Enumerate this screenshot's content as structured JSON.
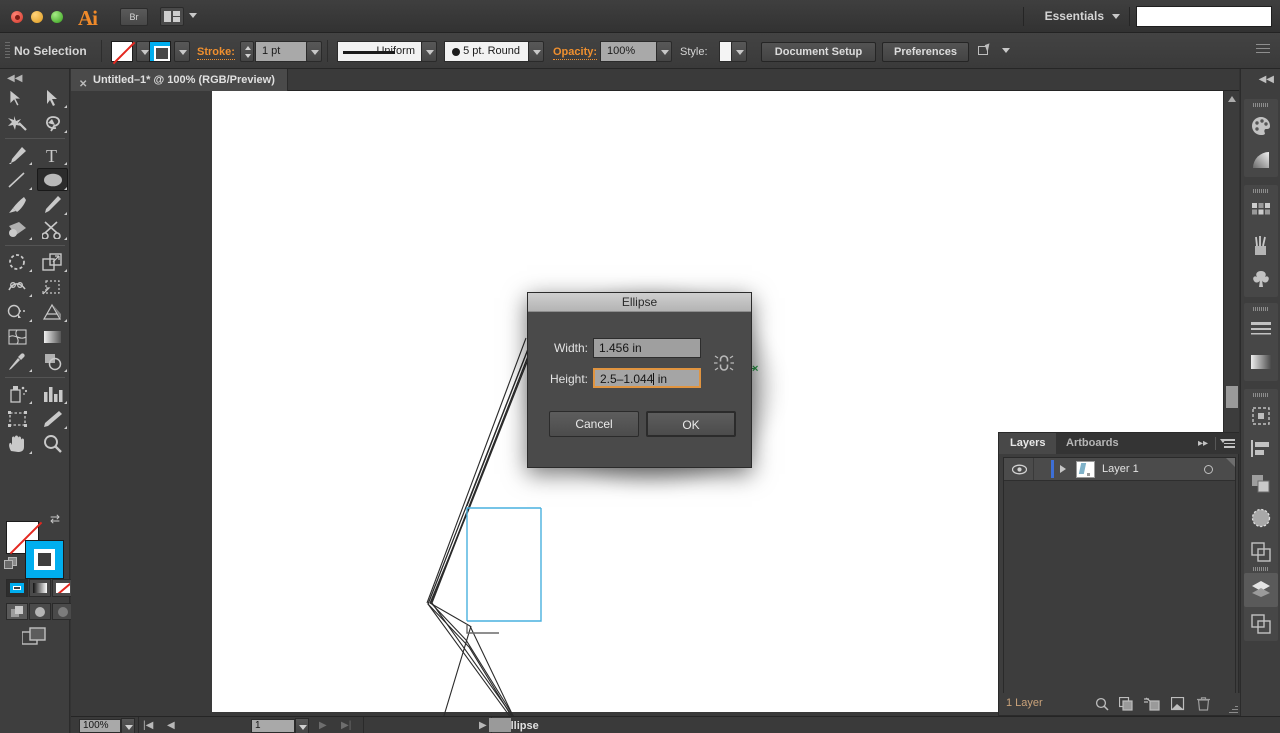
{
  "app": {
    "name": "Adobe Illustrator",
    "logo_text": "Ai",
    "bridge_button": "Br",
    "workspace": "Essentials",
    "search_value": ""
  },
  "control_bar": {
    "selection_status": "No Selection",
    "stroke_label": "Stroke:",
    "stroke_weight": "1 pt",
    "stroke_profile": "Uniform",
    "brush_definition": "5 pt. Round",
    "opacity_label": "Opacity:",
    "opacity_value": "100%",
    "style_label": "Style:",
    "document_setup_button": "Document Setup",
    "preferences_button": "Preferences"
  },
  "document": {
    "tab_title": "Untitled–1* @ 100% (RGB/Preview)"
  },
  "tools": [
    {
      "name": "selection-tool",
      "label": "Selection",
      "selected": false
    },
    {
      "name": "direct-selection-tool",
      "label": "Direct Selection",
      "selected": false
    },
    {
      "name": "magic-wand-tool",
      "label": "Magic Wand",
      "selected": false
    },
    {
      "name": "lasso-tool",
      "label": "Lasso",
      "selected": false
    },
    {
      "name": "pen-tool",
      "label": "Pen",
      "selected": false
    },
    {
      "name": "type-tool",
      "label": "Type",
      "selected": false
    },
    {
      "name": "line-segment-tool",
      "label": "Line Segment",
      "selected": false
    },
    {
      "name": "ellipse-tool",
      "label": "Ellipse",
      "selected": true
    },
    {
      "name": "paintbrush-tool",
      "label": "Paintbrush",
      "selected": false
    },
    {
      "name": "pencil-tool",
      "label": "Pencil",
      "selected": false
    },
    {
      "name": "blob-brush-tool",
      "label": "Blob Brush",
      "selected": false
    },
    {
      "name": "scissors-tool",
      "label": "Scissors",
      "selected": false
    },
    {
      "name": "rotate-tool",
      "label": "Rotate",
      "selected": false
    },
    {
      "name": "scale-tool",
      "label": "Scale",
      "selected": false
    },
    {
      "name": "width-tool",
      "label": "Width",
      "selected": false
    },
    {
      "name": "free-transform-tool",
      "label": "Free Transform",
      "selected": false
    },
    {
      "name": "shape-builder-tool",
      "label": "Shape Builder",
      "selected": false
    },
    {
      "name": "perspective-grid-tool",
      "label": "Perspective Grid",
      "selected": false
    },
    {
      "name": "mesh-tool",
      "label": "Mesh",
      "selected": false
    },
    {
      "name": "gradient-tool",
      "label": "Gradient",
      "selected": false
    },
    {
      "name": "eyedropper-tool",
      "label": "Eyedropper",
      "selected": false
    },
    {
      "name": "blend-tool",
      "label": "Blend",
      "selected": false
    },
    {
      "name": "symbol-sprayer-tool",
      "label": "Symbol Sprayer",
      "selected": false
    },
    {
      "name": "column-graph-tool",
      "label": "Column Graph",
      "selected": false
    },
    {
      "name": "artboard-tool",
      "label": "Artboard",
      "selected": false
    },
    {
      "name": "slice-tool",
      "label": "Slice",
      "selected": false
    },
    {
      "name": "hand-tool",
      "label": "Hand",
      "selected": false
    },
    {
      "name": "zoom-tool",
      "label": "Zoom",
      "selected": false
    }
  ],
  "color_controls": {
    "fill": "none",
    "stroke_color": "#00aeef",
    "modes": [
      "color",
      "gradient",
      "none"
    ],
    "draw_modes": [
      "draw-normal",
      "draw-behind",
      "draw-inside"
    ],
    "active_mode": "color",
    "active_draw_mode": "draw-normal"
  },
  "dialog": {
    "title": "Ellipse",
    "width_label": "Width:",
    "width_value": "1.456 in",
    "height_label": "Height:",
    "height_value": "2.5–1.044",
    "height_unit": "in",
    "constrain_icon": "chain-link-icon",
    "cancel_button": "Cancel",
    "ok_button": "OK",
    "focused_field": "height",
    "accent_color": "#e09440"
  },
  "layers_panel": {
    "tabs": [
      {
        "label": "Layers",
        "active": true
      },
      {
        "label": "Artboards",
        "active": false
      }
    ],
    "rows": [
      {
        "name": "Layer 1",
        "visible": true,
        "locked": false,
        "selected": true
      }
    ],
    "footer_count": "1 Layer",
    "footer_icons": [
      "locate-object-icon",
      "make-mask-icon",
      "new-sublayer-icon",
      "new-layer-icon",
      "delete-layer-icon"
    ]
  },
  "right_dock": {
    "groups": [
      {
        "items": [
          "color-icon",
          "color-guide-icon"
        ]
      },
      {
        "items": [
          "swatches-icon",
          "brushes-icon",
          "symbols-icon"
        ]
      },
      {
        "items": [
          "stroke-icon",
          "gradient-icon"
        ]
      },
      {
        "items": [
          "transform-icon",
          "align-icon",
          "pathfinder-icon",
          "transparency-icon",
          "appearance-icon"
        ]
      },
      {
        "items": [
          "layers-icon",
          "artboards-icon"
        ]
      }
    ],
    "active_item": "layers-icon"
  },
  "status_bar": {
    "zoom_value": "100%",
    "page_value": "1",
    "status_text": "Ellipse"
  },
  "canvas": {
    "shape_stroke_color": "#2b2b2b",
    "active_path_color": "#49b0df",
    "smart_guide_color": "#2fa84f",
    "smart_guide_marker": "×"
  }
}
